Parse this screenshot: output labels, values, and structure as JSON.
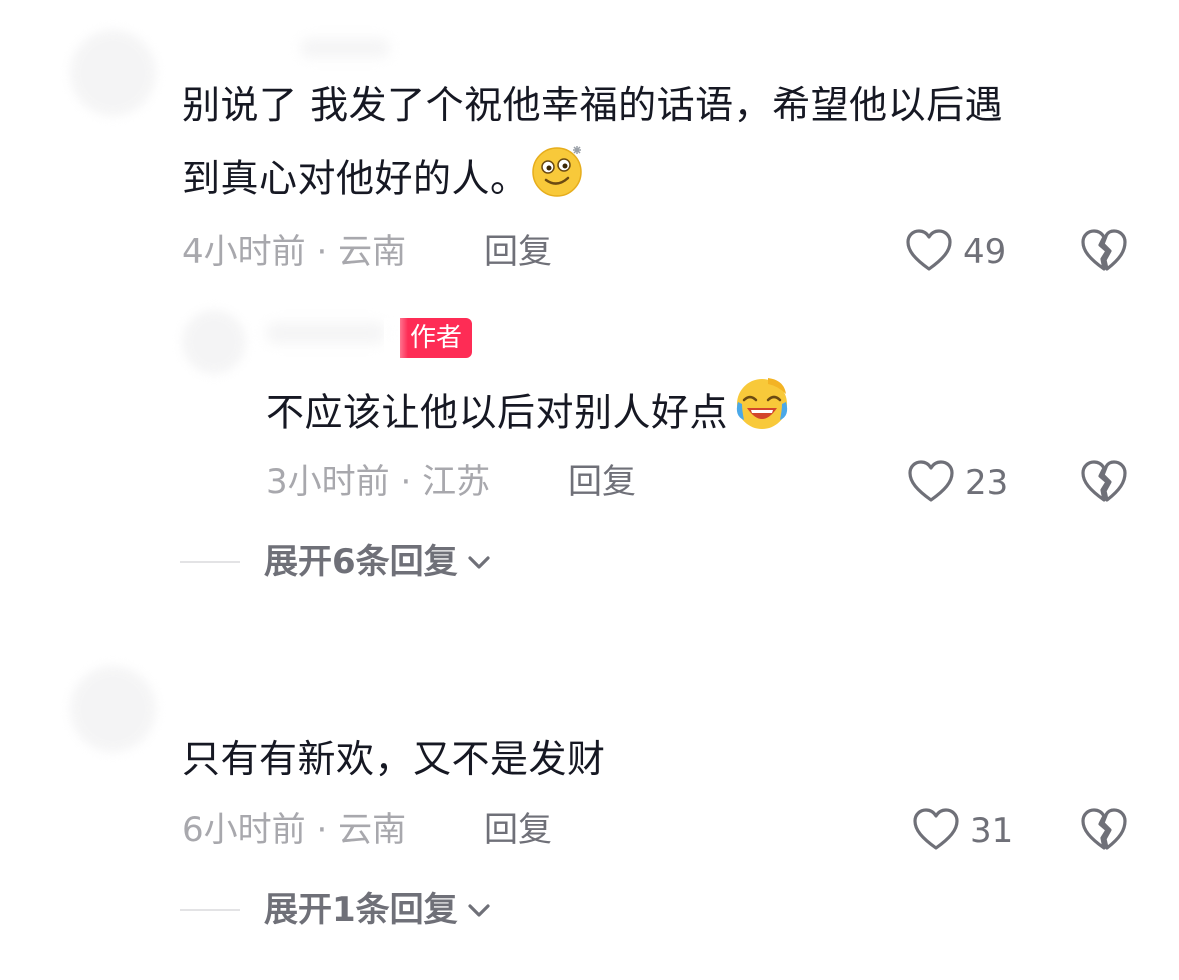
{
  "comments": [
    {
      "text_line1": "别说了 我发了个祝他幸福的话语，希望他以后遇",
      "text_line2": "到真心对他好的人。",
      "emoji": "dizzy-smile-emoji",
      "time": "4小时前",
      "location": "云南",
      "reply_label": "回复",
      "likes": "49"
    },
    {
      "badge": "作者",
      "text": "不应该让他以后对别人好点",
      "emoji": "crying-laughing-emoji",
      "time": "3小时前",
      "location": "江苏",
      "reply_label": "回复",
      "likes": "23"
    },
    {
      "text": "只有有新欢，又不是发财",
      "time": "6小时前",
      "location": "云南",
      "reply_label": "回复",
      "likes": "31"
    }
  ],
  "expand_replies": [
    {
      "label": "展开6条回复"
    },
    {
      "label": "展开1条回复"
    }
  ],
  "meta_separator": " · ",
  "icons": {
    "like": "heart-outline-icon",
    "dislike": "broken-heart-icon",
    "expand": "chevron-down-icon"
  },
  "colors": {
    "text": "#161823",
    "meta": "#a8a8ad",
    "action": "#6f7078",
    "badge": "#fe2c55"
  }
}
